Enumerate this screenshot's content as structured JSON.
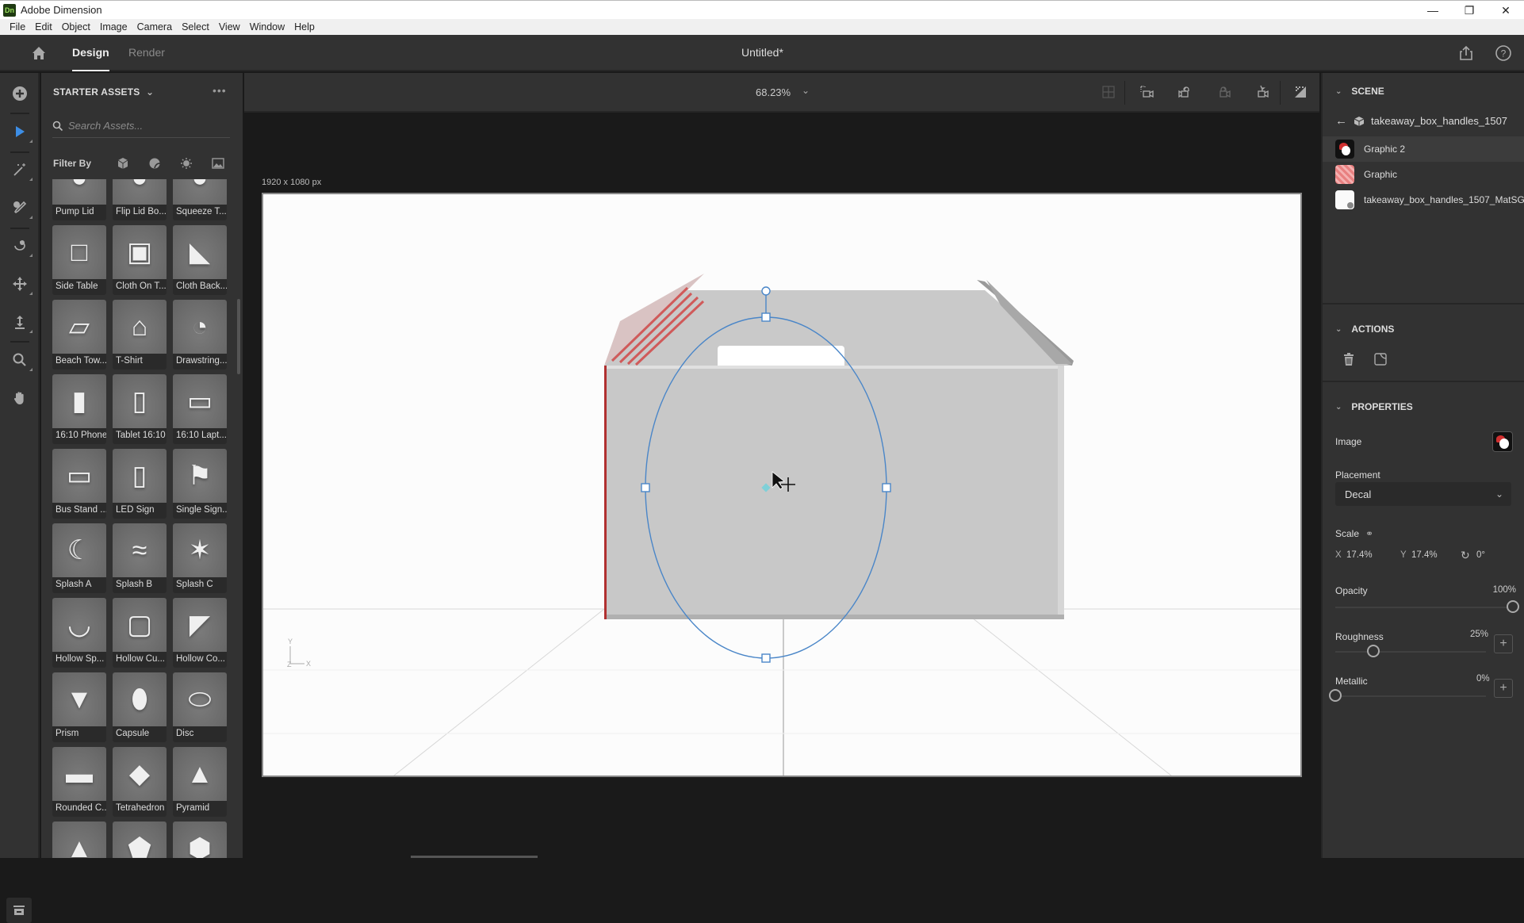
{
  "window": {
    "app_title": "Adobe Dimension",
    "app_logo": "Dn",
    "controls": {
      "minimize": "—",
      "maximize": "❐",
      "close": "✕"
    }
  },
  "menu": [
    "File",
    "Edit",
    "Object",
    "Image",
    "Camera",
    "Select",
    "View",
    "Window",
    "Help"
  ],
  "header": {
    "tabs": [
      {
        "label": "Design",
        "active": true
      },
      {
        "label": "Render",
        "active": false
      }
    ],
    "document_title": "Untitled*",
    "icons": [
      "home-icon",
      "share-icon",
      "help-icon"
    ]
  },
  "left_toolbar": {
    "tools": [
      {
        "name": "add",
        "icon": "plus-circle-icon"
      },
      {
        "name": "select",
        "icon": "arrow-icon",
        "active": true
      },
      {
        "name": "magic-wand",
        "icon": "magic-wand-icon"
      },
      {
        "name": "sample",
        "icon": "eyedropper-icon"
      },
      {
        "name": "orbit",
        "icon": "orbit-icon"
      },
      {
        "name": "pan",
        "icon": "move-icon"
      },
      {
        "name": "dolly",
        "icon": "dolly-icon"
      },
      {
        "name": "zoom",
        "icon": "zoom-icon"
      },
      {
        "name": "hand",
        "icon": "hand-icon"
      }
    ],
    "bottom_button": "library-icon"
  },
  "assets_panel": {
    "title": "STARTER ASSETS",
    "search_placeholder": "Search Assets...",
    "filter_label": "Filter By",
    "filters": [
      "models-icon",
      "materials-icon",
      "lights-icon",
      "images-icon"
    ],
    "items": [
      "Pump Lid",
      "Flip Lid Bo...",
      "Squeeze T...",
      "Side Table",
      "Cloth On T...",
      "Cloth Back...",
      "Beach Tow...",
      "T-Shirt",
      "Drawstring...",
      "16:10 Phone",
      "Tablet 16:10",
      "16:10 Lapt...",
      "Bus Stand ...",
      "LED Sign",
      "Single Sign...",
      "Splash A",
      "Splash B",
      "Splash C",
      "Hollow Sp...",
      "Hollow Cu...",
      "Hollow Co...",
      "Prism",
      "Capsule",
      "Disc",
      "Rounded C...",
      "Tetrahedron",
      "Pyramid",
      "",
      "",
      ""
    ]
  },
  "viewport": {
    "zoom": "68.23%",
    "canvas_size": "1920 x 1080 px",
    "toolbar_icons": [
      "grid-icon",
      "camera-frame-icon",
      "camera-undo-icon",
      "camera-redo-icon",
      "camera-bookmark-icon",
      "render-preview-icon"
    ],
    "axis_labels": {
      "y": "Y",
      "x": "X",
      "z": "Z"
    }
  },
  "scene": {
    "title": "SCENE",
    "root": "takeaway_box_handles_1507",
    "items": [
      {
        "label": "Graphic 2",
        "selected": true,
        "thumb": "graphic2"
      },
      {
        "label": "Graphic",
        "selected": false,
        "thumb": "graphic"
      },
      {
        "label": "takeaway_box_handles_1507_MatSG",
        "selected": false,
        "thumb": "material"
      }
    ]
  },
  "actions": {
    "title": "ACTIONS",
    "icons": [
      "delete-icon",
      "edit-image-icon"
    ]
  },
  "properties": {
    "title": "PROPERTIES",
    "image_label": "Image",
    "placement_label": "Placement",
    "placement_value": "Decal",
    "scale_label": "Scale",
    "scale_x_label": "X",
    "scale_x": "17.4%",
    "scale_y_label": "Y",
    "scale_y": "17.4%",
    "rotation": "0°",
    "opacity_label": "Opacity",
    "opacity": "100%",
    "opacity_fraction": 1.0,
    "roughness_label": "Roughness",
    "roughness": "25%",
    "roughness_fraction": 0.25,
    "metallic_label": "Metallic",
    "metallic": "0%",
    "metallic_fraction": 0.0
  },
  "colors": {
    "accent": "#3d8ee6",
    "selection": "#4a86c8",
    "panel": "#323232",
    "viewport_bg": "#1a1a1a"
  }
}
